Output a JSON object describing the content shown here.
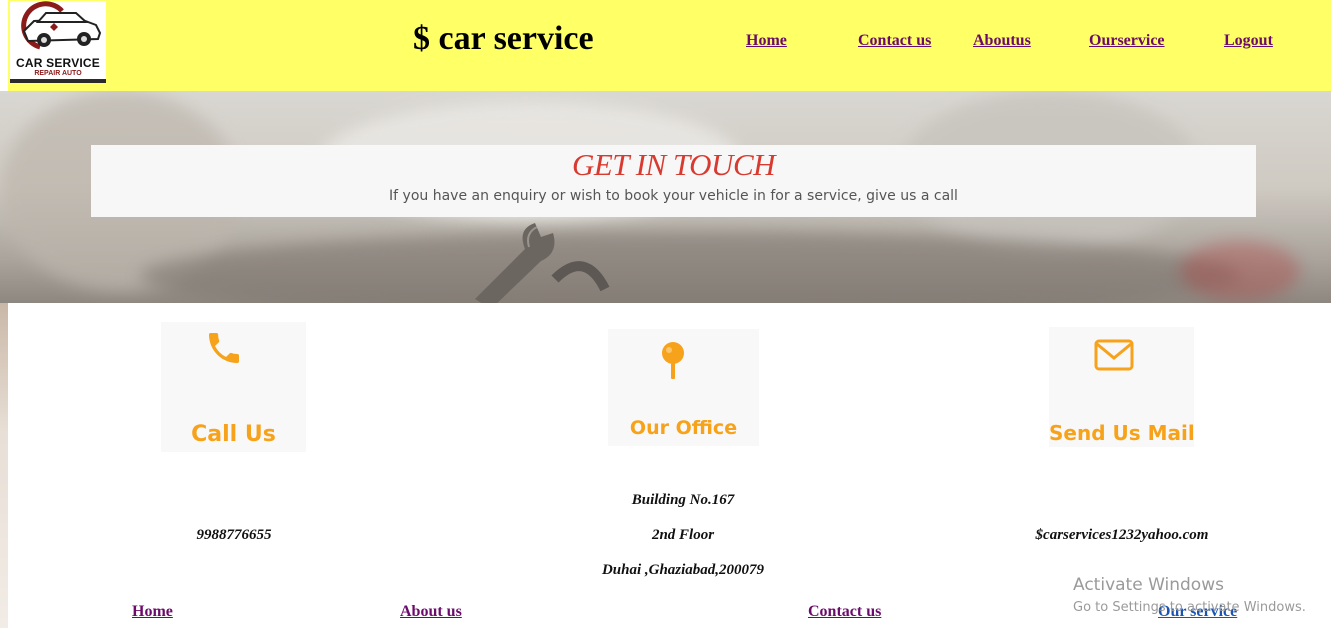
{
  "header": {
    "logo_text_line1": "CAR SERVICE",
    "logo_text_line2": "REPAIR AUTO",
    "site_title": "$ car service",
    "nav": [
      {
        "label": "Home"
      },
      {
        "label": "Contact us"
      },
      {
        "label": "Aboutus"
      },
      {
        "label": "Ourservice"
      },
      {
        "label": "Logout"
      }
    ],
    "bg_color": "#ffff66",
    "link_color": "#6b0b6b"
  },
  "hero": {
    "heading": "GET IN TOUCH",
    "subtext": "If you have an enquiry or wish to book your vehicle in for a service, give us a call",
    "heading_color": "#d83a2f"
  },
  "cards": {
    "call": {
      "label": "Call Us",
      "icon": "phone-icon"
    },
    "office": {
      "label": "Our Office",
      "icon": "map-pin-icon"
    },
    "mail": {
      "label": "Send Us Mail",
      "icon": "envelope-icon"
    },
    "accent_color": "#f7a21b"
  },
  "contact": {
    "phone": "9988776655",
    "address_line1": "Building No.167",
    "address_line2": "2nd Floor",
    "address_line3": "Duhai ,Ghaziabad,200079",
    "email": "$carservices1232yahoo.com"
  },
  "footer": {
    "links": [
      {
        "label": "Home"
      },
      {
        "label": "About us"
      },
      {
        "label": "Contact us"
      },
      {
        "label": "Our service"
      }
    ]
  },
  "watermark": {
    "line1": "Activate Windows",
    "line2": "Go to Settings to activate Windows."
  }
}
